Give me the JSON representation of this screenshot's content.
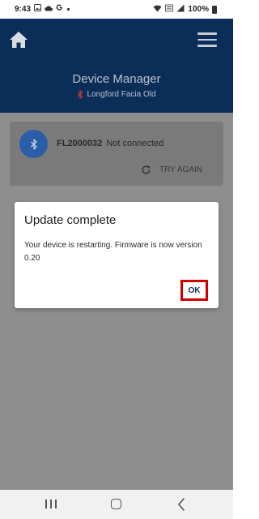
{
  "status_bar": {
    "time": "9:43",
    "notification_icons": [
      "image-icon",
      "cloud-icon",
      "google-g-icon",
      "dot-icon"
    ],
    "system_icons": [
      "wifi-icon",
      "volte-icon",
      "signal-icon"
    ],
    "battery": "100%"
  },
  "header": {
    "title": "Device Manager",
    "subtitle": "Longford Facia Old",
    "colors": {
      "background": "#0b2e59",
      "text": "#b9c0cc",
      "bluetooth_red": "#d23a3a"
    }
  },
  "device_card": {
    "device_id": "FL2000032",
    "status": "Not connected",
    "retry_label": "TRY AGAIN"
  },
  "dialog": {
    "title": "Update complete",
    "message": "Your device is restarting. Firmware is now version 0.20",
    "ok_label": "OK"
  },
  "nav_bar": {
    "icons": [
      "recents-icon",
      "home-nav-icon",
      "back-icon"
    ]
  }
}
